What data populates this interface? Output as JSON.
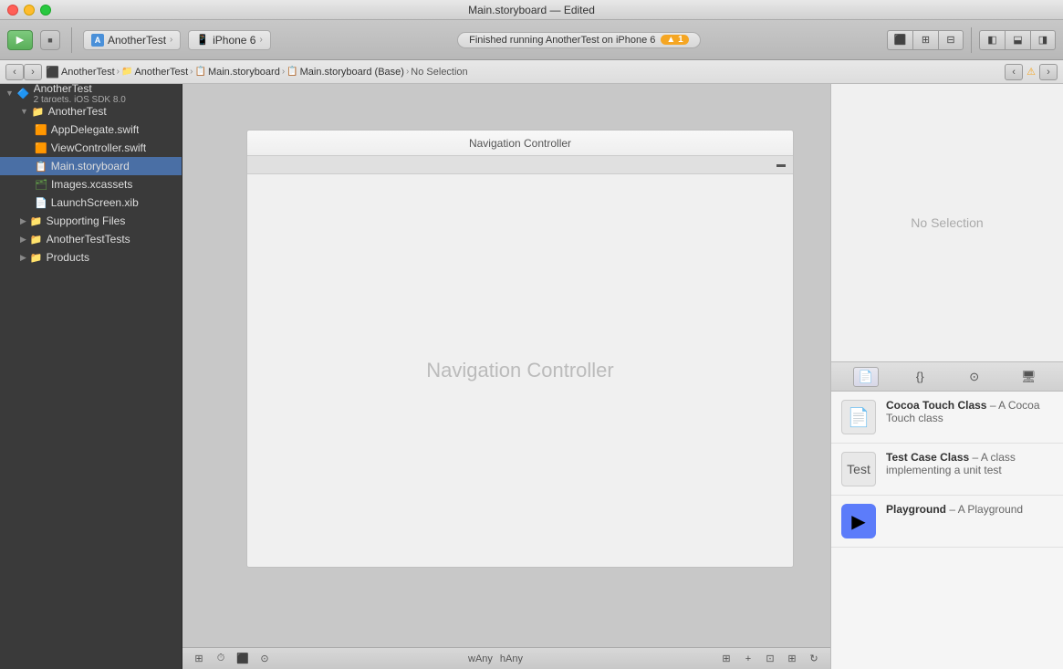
{
  "titleBar": {
    "title": "Main.storyboard — Edited"
  },
  "toolbar": {
    "runButton": "▶",
    "stopButton": "■",
    "schemeName": "AnotherTest",
    "deviceName": "iPhone 6",
    "statusText": "Finished running AnotherTest on iPhone 6",
    "warningCount": "▲ 1"
  },
  "breadcrumb": {
    "items": [
      "AnotherTest",
      "AnotherTest",
      "Main.storyboard",
      "Main.storyboard (Base)",
      "No Selection"
    ]
  },
  "sidebar": {
    "rootLabel": "AnotherTest",
    "rootSub": "2 targets, iOS SDK 8.0",
    "items": [
      {
        "label": "AnotherTest",
        "indent": 1,
        "type": "folder",
        "expanded": true
      },
      {
        "label": "AppDelegate.swift",
        "indent": 2,
        "type": "swift"
      },
      {
        "label": "ViewController.swift",
        "indent": 2,
        "type": "swift"
      },
      {
        "label": "Main.storyboard",
        "indent": 2,
        "type": "storyboard",
        "selected": true
      },
      {
        "label": "Images.xcassets",
        "indent": 2,
        "type": "xcassets"
      },
      {
        "label": "LaunchScreen.xib",
        "indent": 2,
        "type": "xib"
      },
      {
        "label": "Supporting Files",
        "indent": 2,
        "type": "folder",
        "expanded": false
      },
      {
        "label": "AnotherTestTests",
        "indent": 1,
        "type": "folder",
        "expanded": false
      },
      {
        "label": "Products",
        "indent": 1,
        "type": "folder",
        "expanded": false
      }
    ]
  },
  "canvas": {
    "sceneTitle": "Navigation Controller",
    "navControllerLabel": "Navigation Controller",
    "noSelection": "No Selection"
  },
  "inspector": {
    "tabs": [
      "📄",
      "{}",
      "🔲",
      "🖥"
    ],
    "activeTab": 0
  },
  "library": {
    "items": [
      {
        "title": "Cocoa Touch Class",
        "dash": "– A Cocoa Touch class",
        "description": "A Cocoa Touch class",
        "icon": "📄"
      },
      {
        "title": "Test Case Class",
        "dash": "– A class implementing a unit test",
        "description": "A class implementing a unit test",
        "icon": "🧪"
      },
      {
        "title": "Playground",
        "dash": "– A Playground",
        "description": "A Playground",
        "icon": "▶"
      }
    ]
  },
  "bottomBar": {
    "widthText": "wAny",
    "heightText": "hAny"
  }
}
